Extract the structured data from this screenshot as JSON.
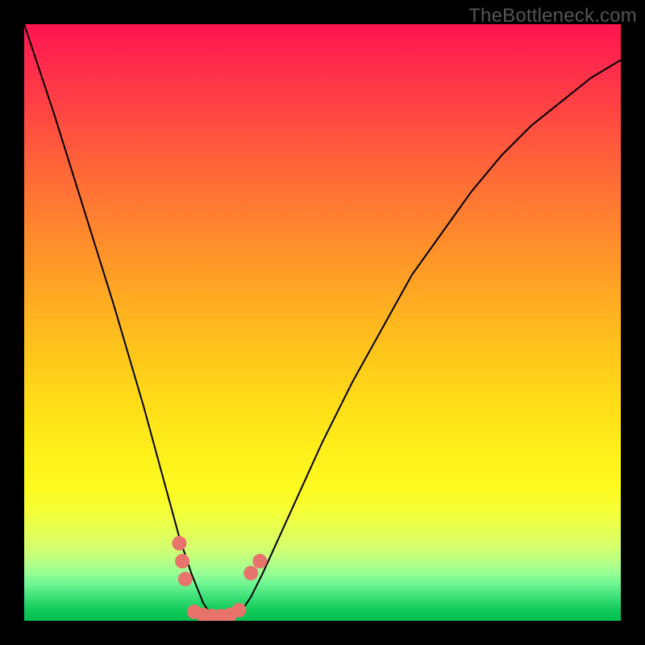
{
  "watermark": "TheBottleneck.com",
  "chart_data": {
    "type": "line",
    "title": "",
    "xlabel": "",
    "ylabel": "",
    "xlim": [
      0,
      1
    ],
    "ylim": [
      0,
      1
    ],
    "series": [
      {
        "name": "bottleneck-curve",
        "x": [
          0.0,
          0.05,
          0.1,
          0.15,
          0.2,
          0.23,
          0.26,
          0.28,
          0.3,
          0.32,
          0.34,
          0.36,
          0.38,
          0.4,
          0.45,
          0.5,
          0.55,
          0.6,
          0.65,
          0.7,
          0.75,
          0.8,
          0.85,
          0.9,
          0.95,
          1.0
        ],
        "y": [
          1.0,
          0.85,
          0.69,
          0.53,
          0.36,
          0.25,
          0.14,
          0.08,
          0.03,
          0.0,
          0.0,
          0.01,
          0.04,
          0.08,
          0.19,
          0.3,
          0.4,
          0.49,
          0.58,
          0.65,
          0.72,
          0.78,
          0.83,
          0.87,
          0.91,
          0.94
        ]
      },
      {
        "name": "markers-left",
        "x": [
          0.26,
          0.265,
          0.27
        ],
        "y": [
          0.13,
          0.1,
          0.07
        ]
      },
      {
        "name": "markers-right",
        "x": [
          0.38,
          0.395
        ],
        "y": [
          0.08,
          0.1
        ]
      },
      {
        "name": "markers-bottom",
        "x": [
          0.285,
          0.3,
          0.315,
          0.33,
          0.345,
          0.36
        ],
        "y": [
          0.015,
          0.01,
          0.008,
          0.008,
          0.01,
          0.018
        ]
      }
    ],
    "marker_color": "#e8736c",
    "line_color": "#000000"
  }
}
